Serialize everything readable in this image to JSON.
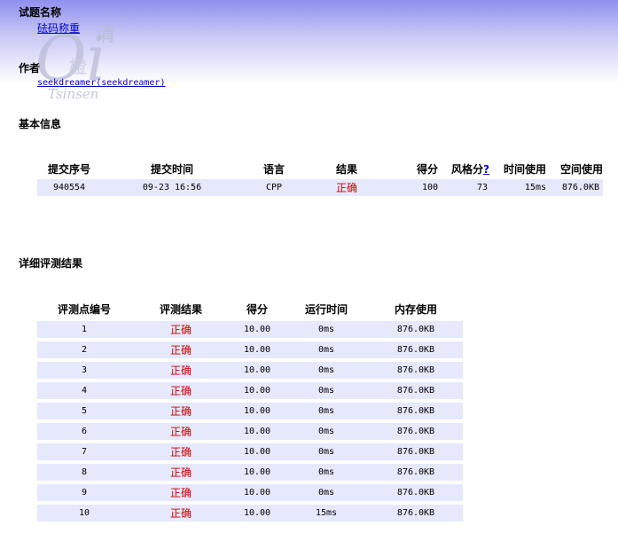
{
  "problem": {
    "heading": "试题名称",
    "name": "砝码称重"
  },
  "author": {
    "heading": "作者",
    "name": "seekdreamer(seekdreamer)"
  },
  "watermark": {
    "big": "Oi",
    "cjk1": "清",
    "cjk2": "橙",
    "sub": "Tsinsen"
  },
  "basic": {
    "heading": "基本信息",
    "columns": [
      "提交序号",
      "提交时间",
      "语言",
      "结果",
      "得分",
      "风格分",
      "时间使用",
      "空间使用"
    ],
    "help_mark": "?",
    "row": {
      "id": "940554",
      "time": "09-23 16:56",
      "lang": "CPP",
      "result": "正确",
      "score": "100",
      "style": "73",
      "time_used": "15ms",
      "mem_used": "876.0KB"
    }
  },
  "detail": {
    "heading": "详细评测结果",
    "columns": [
      "评测点编号",
      "评测结果",
      "得分",
      "运行时间",
      "内存使用"
    ],
    "rows": [
      {
        "no": "1",
        "result": "正确",
        "score": "10.00",
        "time": "0ms",
        "mem": "876.0KB"
      },
      {
        "no": "2",
        "result": "正确",
        "score": "10.00",
        "time": "0ms",
        "mem": "876.0KB"
      },
      {
        "no": "3",
        "result": "正确",
        "score": "10.00",
        "time": "0ms",
        "mem": "876.0KB"
      },
      {
        "no": "4",
        "result": "正确",
        "score": "10.00",
        "time": "0ms",
        "mem": "876.0KB"
      },
      {
        "no": "5",
        "result": "正确",
        "score": "10.00",
        "time": "0ms",
        "mem": "876.0KB"
      },
      {
        "no": "6",
        "result": "正确",
        "score": "10.00",
        "time": "0ms",
        "mem": "876.0KB"
      },
      {
        "no": "7",
        "result": "正确",
        "score": "10.00",
        "time": "0ms",
        "mem": "876.0KB"
      },
      {
        "no": "8",
        "result": "正确",
        "score": "10.00",
        "time": "0ms",
        "mem": "876.0KB"
      },
      {
        "no": "9",
        "result": "正确",
        "score": "10.00",
        "time": "0ms",
        "mem": "876.0KB"
      },
      {
        "no": "10",
        "result": "正确",
        "score": "10.00",
        "time": "15ms",
        "mem": "876.0KB"
      }
    ]
  },
  "colors": {
    "row_bg": "#e6e8fb",
    "ok": "#cc0000",
    "link": "#0000cc",
    "header_top": "#8f8fef"
  }
}
